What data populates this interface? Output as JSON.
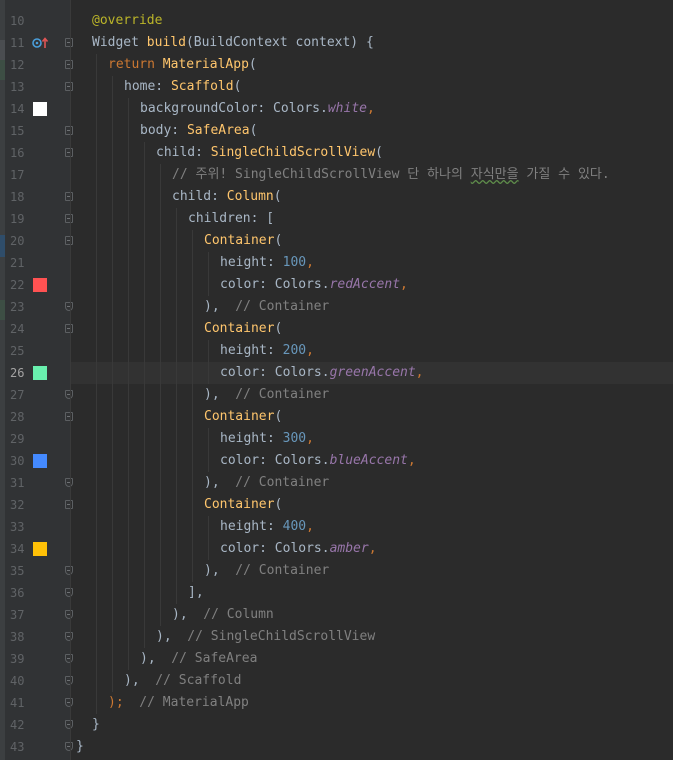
{
  "editor": {
    "language": "dart",
    "current_line": 26,
    "swatch_colors": {
      "white": "#ffffff",
      "redAccent": "#ff5252",
      "greenAccent": "#69f0ae",
      "blueAccent": "#448aff",
      "amber": "#ffc107"
    },
    "lines": [
      {
        "n": "10",
        "indent": 1,
        "tokens": [
          {
            "t": "@override",
            "c": "ann"
          }
        ]
      },
      {
        "n": "11",
        "indent": 1,
        "icon": "override-icon",
        "tokens": [
          {
            "t": "Widget ",
            "c": ""
          },
          {
            "t": "build",
            "c": "fn"
          },
          {
            "t": "(BuildContext context) {",
            "c": ""
          }
        ]
      },
      {
        "n": "12",
        "indent": 2,
        "tokens": [
          {
            "t": "return ",
            "c": "kw"
          },
          {
            "t": "MaterialApp",
            "c": "cls"
          },
          {
            "t": "(",
            "c": ""
          }
        ]
      },
      {
        "n": "13",
        "indent": 3,
        "tokens": [
          {
            "t": "home: ",
            "c": ""
          },
          {
            "t": "Scaffold",
            "c": "cls"
          },
          {
            "t": "(",
            "c": ""
          }
        ]
      },
      {
        "n": "14",
        "indent": 4,
        "swatch": "white",
        "tokens": [
          {
            "t": "backgroundColor: Colors.",
            "c": ""
          },
          {
            "t": "white",
            "c": "field"
          },
          {
            "t": ",",
            "c": "kw"
          }
        ]
      },
      {
        "n": "15",
        "indent": 4,
        "tokens": [
          {
            "t": "body: ",
            "c": ""
          },
          {
            "t": "SafeArea",
            "c": "cls"
          },
          {
            "t": "(",
            "c": ""
          }
        ]
      },
      {
        "n": "16",
        "indent": 5,
        "tokens": [
          {
            "t": "child: ",
            "c": ""
          },
          {
            "t": "SingleChildScrollView",
            "c": "cls"
          },
          {
            "t": "(",
            "c": ""
          }
        ]
      },
      {
        "n": "17",
        "indent": 6,
        "tokens": [
          {
            "t": "// 주위! SingleChildScrollView 단 하나의 ",
            "c": "cm"
          },
          {
            "t": "자식만을",
            "c": "cm wavy"
          },
          {
            "t": " 가질 수 있다.",
            "c": "cm"
          }
        ]
      },
      {
        "n": "18",
        "indent": 6,
        "tokens": [
          {
            "t": "child: ",
            "c": ""
          },
          {
            "t": "Column",
            "c": "cls"
          },
          {
            "t": "(",
            "c": ""
          }
        ]
      },
      {
        "n": "19",
        "indent": 7,
        "tokens": [
          {
            "t": "children: [",
            "c": ""
          }
        ]
      },
      {
        "n": "20",
        "indent": 8,
        "tokens": [
          {
            "t": "Container",
            "c": "cls"
          },
          {
            "t": "(",
            "c": ""
          }
        ]
      },
      {
        "n": "21",
        "indent": 9,
        "tokens": [
          {
            "t": "height: ",
            "c": ""
          },
          {
            "t": "100",
            "c": "num"
          },
          {
            "t": ",",
            "c": "kw"
          }
        ]
      },
      {
        "n": "22",
        "indent": 9,
        "swatch": "redAccent",
        "tokens": [
          {
            "t": "color: Colors.",
            "c": ""
          },
          {
            "t": "redAccent",
            "c": "field"
          },
          {
            "t": ",",
            "c": "kw"
          }
        ]
      },
      {
        "n": "23",
        "indent": 8,
        "tokens": [
          {
            "t": "),",
            "c": ""
          },
          {
            "t": "  // Container",
            "c": "cm"
          }
        ]
      },
      {
        "n": "24",
        "indent": 8,
        "tokens": [
          {
            "t": "Container",
            "c": "cls"
          },
          {
            "t": "(",
            "c": ""
          }
        ]
      },
      {
        "n": "25",
        "indent": 9,
        "tokens": [
          {
            "t": "height: ",
            "c": ""
          },
          {
            "t": "200",
            "c": "num"
          },
          {
            "t": ",",
            "c": "kw"
          }
        ]
      },
      {
        "n": "26",
        "indent": 9,
        "swatch": "greenAccent",
        "tokens": [
          {
            "t": "color: Colors.",
            "c": ""
          },
          {
            "t": "greenAccent",
            "c": "field"
          },
          {
            "t": ",",
            "c": "kw"
          }
        ]
      },
      {
        "n": "27",
        "indent": 8,
        "tokens": [
          {
            "t": "),",
            "c": ""
          },
          {
            "t": "  // Container",
            "c": "cm"
          }
        ]
      },
      {
        "n": "28",
        "indent": 8,
        "tokens": [
          {
            "t": "Container",
            "c": "cls"
          },
          {
            "t": "(",
            "c": ""
          }
        ]
      },
      {
        "n": "29",
        "indent": 9,
        "tokens": [
          {
            "t": "height: ",
            "c": ""
          },
          {
            "t": "300",
            "c": "num"
          },
          {
            "t": ",",
            "c": "kw"
          }
        ]
      },
      {
        "n": "30",
        "indent": 9,
        "swatch": "blueAccent",
        "tokens": [
          {
            "t": "color: Colors.",
            "c": ""
          },
          {
            "t": "blueAccent",
            "c": "field"
          },
          {
            "t": ",",
            "c": "kw"
          }
        ]
      },
      {
        "n": "31",
        "indent": 8,
        "tokens": [
          {
            "t": "),",
            "c": ""
          },
          {
            "t": "  // Container",
            "c": "cm"
          }
        ]
      },
      {
        "n": "32",
        "indent": 8,
        "tokens": [
          {
            "t": "Container",
            "c": "cls"
          },
          {
            "t": "(",
            "c": ""
          }
        ]
      },
      {
        "n": "33",
        "indent": 9,
        "tokens": [
          {
            "t": "height: ",
            "c": ""
          },
          {
            "t": "400",
            "c": "num"
          },
          {
            "t": ",",
            "c": "kw"
          }
        ]
      },
      {
        "n": "34",
        "indent": 9,
        "swatch": "amber",
        "tokens": [
          {
            "t": "color: Colors.",
            "c": ""
          },
          {
            "t": "amber",
            "c": "field"
          },
          {
            "t": ",",
            "c": "kw"
          }
        ]
      },
      {
        "n": "35",
        "indent": 8,
        "tokens": [
          {
            "t": "),",
            "c": ""
          },
          {
            "t": "  // Container",
            "c": "cm"
          }
        ]
      },
      {
        "n": "36",
        "indent": 7,
        "tokens": [
          {
            "t": "],",
            "c": ""
          }
        ]
      },
      {
        "n": "37",
        "indent": 6,
        "tokens": [
          {
            "t": "),",
            "c": ""
          },
          {
            "t": "  // Column",
            "c": "cm"
          }
        ]
      },
      {
        "n": "38",
        "indent": 5,
        "tokens": [
          {
            "t": "),",
            "c": ""
          },
          {
            "t": "  // SingleChildScrollView",
            "c": "cm"
          }
        ]
      },
      {
        "n": "39",
        "indent": 4,
        "tokens": [
          {
            "t": "),",
            "c": ""
          },
          {
            "t": "  // SafeArea",
            "c": "cm"
          }
        ]
      },
      {
        "n": "40",
        "indent": 3,
        "tokens": [
          {
            "t": "),",
            "c": ""
          },
          {
            "t": "  // Scaffold",
            "c": "cm"
          }
        ]
      },
      {
        "n": "41",
        "indent": 2,
        "tokens": [
          {
            "t": ");",
            "c": "kw"
          },
          {
            "t": "  // MaterialApp",
            "c": "cm"
          }
        ]
      },
      {
        "n": "42",
        "indent": 1,
        "tokens": [
          {
            "t": "}",
            "c": ""
          }
        ]
      },
      {
        "n": "43",
        "indent": 0,
        "tokens": [
          {
            "t": "}",
            "c": ""
          }
        ]
      }
    ]
  }
}
